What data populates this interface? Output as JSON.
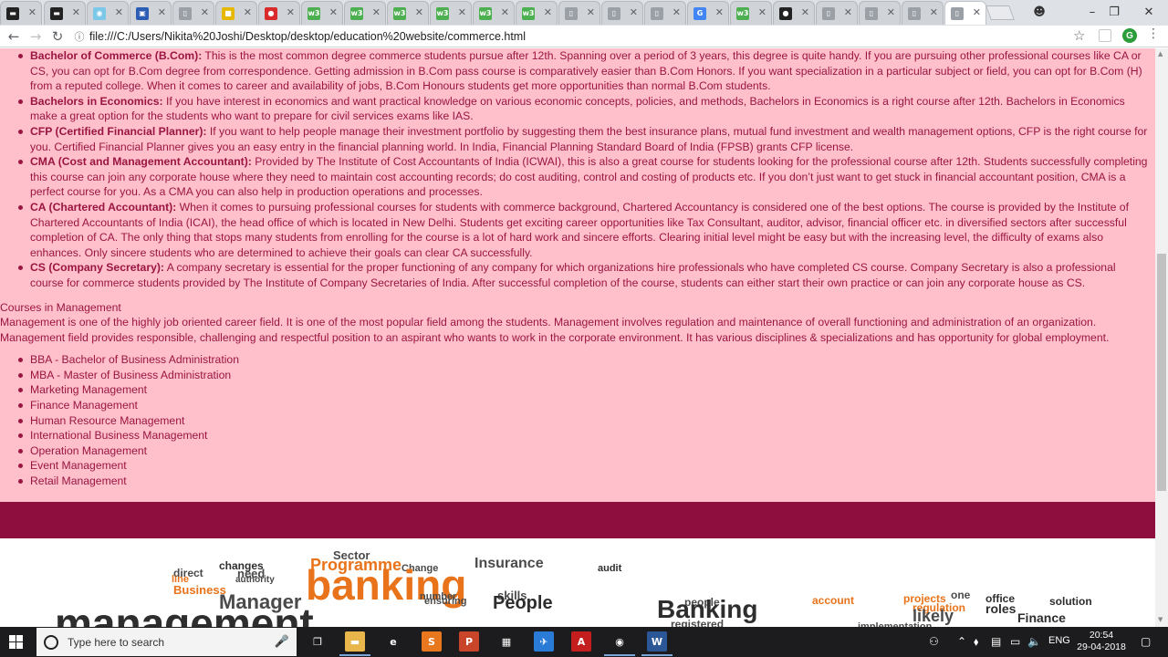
{
  "browser": {
    "address": "file:///C:/Users/Nikita%20Joshi/Desktop/desktop/education%20website/commerce.html",
    "tabs": [
      {
        "icon": "cap-icon",
        "color": "#222222",
        "glyph": "▬"
      },
      {
        "icon": "cap-icon",
        "color": "#222222",
        "glyph": "▬"
      },
      {
        "icon": "globe-icon",
        "color": "#7cc8e8",
        "glyph": "◉"
      },
      {
        "icon": "photo-icon",
        "color": "#2b5db5",
        "glyph": "▣"
      },
      {
        "icon": "page-icon",
        "color": "#9aa0a6",
        "glyph": "▯"
      },
      {
        "icon": "yellow-app-icon",
        "color": "#e6b800",
        "glyph": "■"
      },
      {
        "icon": "opera-icon",
        "color": "#d92b2b",
        "glyph": "●"
      },
      {
        "icon": "w3-icon",
        "color": "#4caf50",
        "glyph": "w3"
      },
      {
        "icon": "w3-icon",
        "color": "#4caf50",
        "glyph": "w3"
      },
      {
        "icon": "w3-icon",
        "color": "#4caf50",
        "glyph": "w3"
      },
      {
        "icon": "w3-icon",
        "color": "#4caf50",
        "glyph": "w3"
      },
      {
        "icon": "w3-icon",
        "color": "#4caf50",
        "glyph": "w3"
      },
      {
        "icon": "w3-icon",
        "color": "#4caf50",
        "glyph": "w3"
      },
      {
        "icon": "page-icon",
        "color": "#9aa0a6",
        "glyph": "▯"
      },
      {
        "icon": "page-icon",
        "color": "#9aa0a6",
        "glyph": "▯"
      },
      {
        "icon": "page-icon",
        "color": "#9aa0a6",
        "glyph": "▯"
      },
      {
        "icon": "google-icon",
        "color": "#4285f4",
        "glyph": "G"
      },
      {
        "icon": "w3-icon",
        "color": "#4caf50",
        "glyph": "w3"
      },
      {
        "icon": "github-icon",
        "color": "#222222",
        "glyph": "●"
      },
      {
        "icon": "page-icon",
        "color": "#9aa0a6",
        "glyph": "▯"
      },
      {
        "icon": "page-icon",
        "color": "#9aa0a6",
        "glyph": "▯"
      },
      {
        "icon": "page-icon",
        "color": "#9aa0a6",
        "glyph": "▯"
      },
      {
        "icon": "page-icon",
        "color": "#9aa0a6",
        "glyph": "▯",
        "active": true
      }
    ]
  },
  "page": {
    "commerce_courses": [
      {
        "title": "Bachelor of Commerce (B.Com):",
        "text": " This is the most common degree commerce students pursue after 12th. Spanning over a period of 3 years, this degree is quite handy. If you are pursuing other professional courses like CA or CS, you can opt for B.Com degree from correspondence. Getting admission in B.Com pass course is comparatively easier than B.Com Honors. If you want specialization in a particular subject or field, you can opt for B.Com (H) from a reputed college. When it comes to career and availability of jobs, B.Com Honours students get more opportunities than normal B.Com students."
      },
      {
        "title": "Bachelors in Economics:",
        "text": " If you have interest in economics and want practical knowledge on various economic concepts, policies, and methods, Bachelors in Economics is a right course after 12th. Bachelors in Economics make a great option for the students who want to prepare for civil services exams like IAS."
      },
      {
        "title": "CFP (Certified Financial Planner):",
        "text": " If you want to help people manage their investment portfolio by suggesting them the best insurance plans, mutual fund investment and wealth management options, CFP is the right course for you. Certified Financial Planner gives you an easy entry in the financial planning world. In India, Financial Planning Standard Board of India (FPSB) grants CFP license."
      },
      {
        "title": "CMA (Cost and Management Accountant):",
        "text": " Provided by The Institute of Cost Accountants of India (ICWAI), this is also a great course for students looking for the professional course after 12th. Students successfully completing this course can join any corporate house where they need to maintain cost accounting records; do cost auditing, control and costing of products etc. If you don’t just want to get stuck in financial accountant position, CMA is a perfect course for you. As a CMA you can also help in production operations and processes."
      },
      {
        "title": "CA (Chartered Accountant):",
        "text": " When it comes to pursuing professional courses for students with commerce background, Chartered Accountancy is considered one of the best options. The course is provided by the Institute of Chartered Accountants of India (ICAI), the head office of which is located in New Delhi. Students get exciting career opportunities like Tax Consultant, auditor, advisor, financial officer etc. in diversified sectors after successful completion of CA. The only thing that stops many students from enrolling for the course is a lot of hard work and sincere efforts. Clearing initial level might be easy but with the increasing level, the difficulty of exams also enhances. Only sincere students who are determined to achieve their goals can clear CA successfully."
      },
      {
        "title": "CS (Company Secretary):",
        "text": " A company secretary is essential for the proper functioning of any company for which organizations hire professionals who have completed CS course. Company Secretary is also a professional course for commerce students provided by The Institute of Company Secretaries of India. After successful completion of the course, students can either start their own practice or can join any corporate house as CS."
      }
    ],
    "management_heading": "Courses in Management",
    "management_para": "Management is one of the highly job oriented career field. It is one of the most popular field among the students. Management involves regulation and maintenance of overall functioning and administration of an organization. Management field provides responsible, challenging and respectful position to an aspirant who wants to work in the corporate environment. It has various disciplines & specializations and has opportunity for global employment.",
    "management_courses": [
      "BBA - Bachelor of Business Administration",
      "MBA - Master of Business Administration",
      "Marketing Management",
      "Finance Management",
      "Human Resource Management",
      "International Business Management",
      "Operation Management",
      "Event Management",
      "Retail Management"
    ],
    "word_cloud": {
      "words": [
        "Sector",
        "Programme",
        "Insurance",
        "changes",
        "direct",
        "need",
        "line",
        "authority",
        "Change",
        "audit",
        "banking",
        "Business",
        "Manager",
        "ensuring",
        "number",
        "skills",
        "People",
        "one",
        "office",
        "people",
        "projects",
        "solution",
        "Banking",
        "account",
        "regulation",
        "roles",
        "likely",
        "Finance",
        "management",
        "registered",
        "implementation"
      ],
      "colors": {
        "orange": "#e8731a",
        "gray": "#4a4a4a",
        "dark": "#2e2e2e"
      }
    }
  },
  "taskbar": {
    "search_placeholder": "Type here to search",
    "language": "ENG",
    "time": "20:54",
    "date": "29-04-2018",
    "apps": [
      {
        "name": "task-view-icon",
        "color": "#1c1c1e",
        "glyph": "❐"
      },
      {
        "name": "file-explorer-icon",
        "color": "#e8b64a",
        "glyph": "▬"
      },
      {
        "name": "edge-icon",
        "color": "#1c1c1e",
        "glyph": "e"
      },
      {
        "name": "sublime-icon",
        "color": "#e8781e",
        "glyph": "S"
      },
      {
        "name": "powerpoint-icon",
        "color": "#c8452a",
        "glyph": "P"
      },
      {
        "name": "store-icon",
        "color": "#1c1c1e",
        "glyph": "▦"
      },
      {
        "name": "mail-icon",
        "color": "#2a7bd6",
        "glyph": "✈"
      },
      {
        "name": "acrobat-icon",
        "color": "#c41e1e",
        "glyph": "A"
      },
      {
        "name": "chrome-icon",
        "color": "#1c1c1e",
        "glyph": "◉"
      },
      {
        "name": "word-icon",
        "color": "#2b5797",
        "glyph": "W"
      }
    ]
  }
}
